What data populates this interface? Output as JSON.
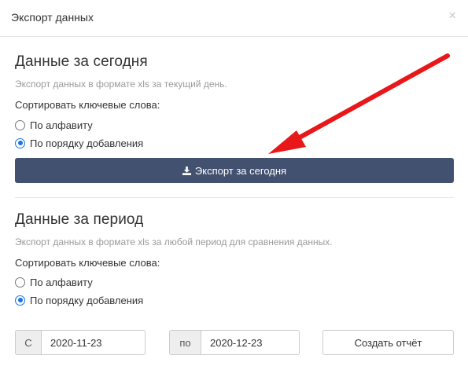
{
  "modal": {
    "title": "Экспорт данных",
    "close_symbol": "×"
  },
  "today_section": {
    "title": "Данные за сегодня",
    "description": "Экспорт данных в формате xls за текущий день.",
    "sort_label": "Сортировать ключевые слова:",
    "options": [
      {
        "label": "По алфавиту",
        "checked": false
      },
      {
        "label": "По порядку добавления",
        "checked": true
      }
    ],
    "export_button": {
      "label": "Экспорт за сегодня",
      "icon": "download-icon"
    }
  },
  "period_section": {
    "title": "Данные за период",
    "description": "Экспорт данных в формате xls за любой период для сравнения данных.",
    "sort_label": "Сортировать ключевые слова:",
    "options": [
      {
        "label": "По алфавиту",
        "checked": false
      },
      {
        "label": "По порядку добавления",
        "checked": true
      }
    ],
    "date_from": {
      "prefix": "С",
      "value": "2020-11-23"
    },
    "date_to": {
      "prefix": "по",
      "value": "2020-12-23"
    },
    "create_button": {
      "label": "Создать отчёт"
    }
  },
  "colors": {
    "button_bg": "#435170",
    "radio_accent": "#1a73e8",
    "annotation_arrow": "#e8171a"
  }
}
